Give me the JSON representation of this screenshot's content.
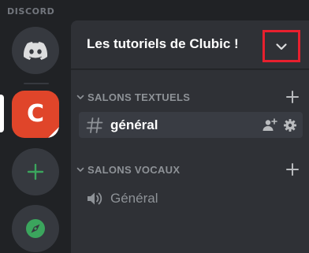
{
  "app": {
    "brand": "DISCORD"
  },
  "guilds": [
    {
      "name": "home",
      "icon": "discord-logo-icon"
    },
    {
      "name": "Les tutoriels de Clubic !",
      "letter": "C",
      "selected": true
    },
    {
      "name": "add-server",
      "icon": "plus-icon"
    },
    {
      "name": "explore",
      "icon": "compass-icon"
    }
  ],
  "server": {
    "name": "Les tutoriels de Clubic !",
    "dropdown_icon": "chevron-down-icon",
    "highlight_color": "#e8202e"
  },
  "categories": {
    "text": {
      "label": "SALONS TEXTUELS"
    },
    "voice": {
      "label": "SALONS VOCAUX"
    }
  },
  "channels": {
    "text": [
      {
        "name": "général",
        "icon": "hashtag-icon",
        "selected": true
      }
    ],
    "voice": [
      {
        "name": "Général",
        "icon": "speaker-icon"
      }
    ]
  },
  "colors": {
    "accent_green": "#3ba55d",
    "clubic_orange": "#e0452a"
  }
}
